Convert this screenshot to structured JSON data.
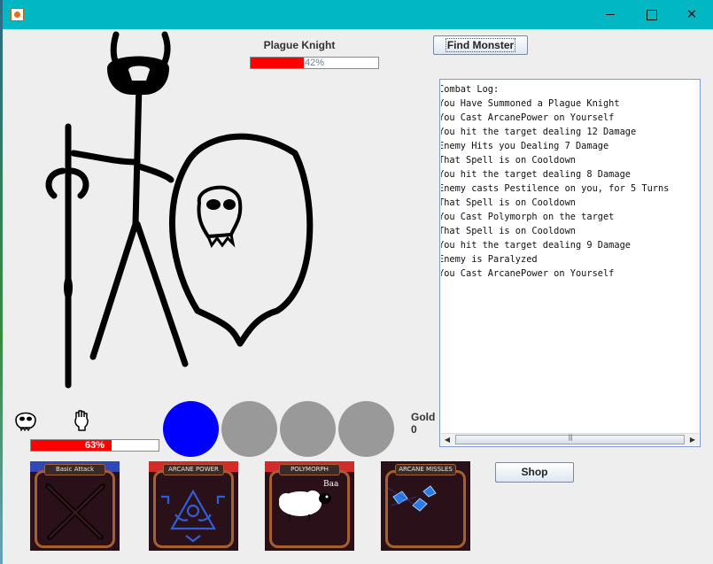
{
  "window": {
    "minimize_glyph": "",
    "maximize_glyph": "",
    "close_glyph": "✕"
  },
  "enemy": {
    "name": "Plague Knight",
    "health_percent_label": "42%",
    "health_fraction": 0.42
  },
  "buttons": {
    "find_monster": "Find Monster",
    "shop": "Shop"
  },
  "combat_log": [
    "Combat Log:",
    "You Have Summoned a Plague Knight",
    "You Cast ArcanePower on Yourself",
    "You hit the target dealing 12 Damage",
    "Enemy Hits you Dealing 7 Damage",
    "That Spell is on Cooldown",
    "You hit the target dealing 8 Damage",
    "Enemy casts Pestilence on you, for 5 Turns",
    "That Spell is on Cooldown",
    "You Cast Polymorph on the target",
    "That Spell is on Cooldown",
    "You hit the target dealing 9 Damage",
    "Enemy is Paralyzed",
    "You Cast ArcanePower on Yourself"
  ],
  "player": {
    "health_percent_label": "63%",
    "health_fraction": 0.63
  },
  "gold": {
    "label": "Gold",
    "value": "0"
  },
  "colors": {
    "titlebar": "#00b7c3",
    "health_fill": "#ff0000",
    "mana_orb_active": "#0000ff",
    "mana_orb_empty": "#999999"
  },
  "spells": [
    {
      "name": "Basic Attack",
      "icon": "crossed-swords-icon"
    },
    {
      "name": "ARCANE POWER",
      "icon": "arcane-triangle-icon"
    },
    {
      "name": "POLYMORPH",
      "icon": "sheep-icon",
      "caption": "Baa"
    },
    {
      "name": "ARCANE MISSLES",
      "icon": "arcane-missiles-icon"
    }
  ]
}
